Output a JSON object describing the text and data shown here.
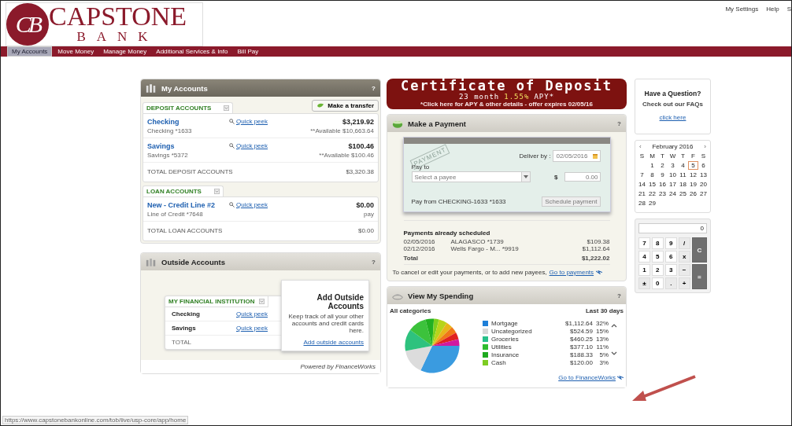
{
  "header": {
    "logo_initials": "CB",
    "logo_name": "CAPSTONE",
    "logo_sub": "BANK",
    "links": [
      "My Settings",
      "Help",
      "S"
    ]
  },
  "nav": [
    {
      "label": "My Accounts",
      "selected": true
    },
    {
      "label": "Move Money",
      "selected": false
    },
    {
      "label": "Manage Money",
      "selected": false
    },
    {
      "label": "Additional Services & Info",
      "selected": false
    },
    {
      "label": "Bill Pay",
      "selected": false
    }
  ],
  "my_accounts": {
    "title": "My Accounts",
    "help": "?",
    "transfer_button": "Make a transfer",
    "groups": [
      {
        "tab": "DEPOSIT ACCOUNTS",
        "total_label": "TOTAL DEPOSIT ACCOUNTS",
        "total": "$3,320.38",
        "accounts": [
          {
            "name": "Checking",
            "number": "Checking *1633",
            "peek": "Quick peek",
            "balance": "$3,219.92",
            "note": "**Available $10,663.64"
          },
          {
            "name": "Savings",
            "number": "Savings *5372",
            "peek": "Quick peek",
            "balance": "$100.46",
            "note": "**Available $100.46"
          }
        ]
      },
      {
        "tab": "LOAN ACCOUNTS",
        "total_label": "TOTAL LOAN ACCOUNTS",
        "total": "$0.00",
        "accounts": [
          {
            "name": "New - Credit Line #2",
            "number": "Line of Credit *7648",
            "peek": "Quick peek",
            "balance": "$0.00",
            "note": "pay"
          }
        ]
      }
    ]
  },
  "outside_accounts": {
    "title": "Outside Accounts",
    "help": "?",
    "tab": "MY FINANCIAL INSTITUTION",
    "rows": [
      {
        "name": "Checking",
        "peek": "Quick peek"
      },
      {
        "name": "Savings",
        "peek": "Quick peek"
      }
    ],
    "total_label": "TOTAL",
    "promo_title": "Add Outside Accounts",
    "promo_text": "Keep track of all your other accounts and credit cards here.",
    "promo_link": "Add outside accounts",
    "powered_by": "Powered by FinanceWorks"
  },
  "cd_banner": {
    "title": "Certificate of Deposit",
    "term": "23 month",
    "rate": "1.55%",
    "apy": "APY*",
    "fine_print": "*Click here for APY & other details - offer expires 02/05/16"
  },
  "payment": {
    "title": "Make a Payment",
    "help": "?",
    "stamp": "PAYMENT",
    "deliver_label": "Deliver by :",
    "deliver_date": "02/05/2016",
    "pay_to_label": "Pay to",
    "payee_placeholder": "Select a payee",
    "currency": "$",
    "amount": "0.00",
    "pay_from": "Pay from CHECKING-1633 *1633",
    "schedule_button": "Schedule payment",
    "schedule_disabled": true,
    "scheduled_title": "Payments already scheduled",
    "scheduled": [
      {
        "date": "02/05/2016",
        "payee": "ALAGASCO *1739",
        "amount": "$109.38"
      },
      {
        "date": "02/12/2016",
        "payee": "Wells Fargo - M... *9919",
        "amount": "$1,112.64"
      }
    ],
    "total_label": "Total",
    "total": "$1,222.02",
    "footer_text": "To cancel or edit your payments, or to add new payees,",
    "footer_link": "Go to payments"
  },
  "spending": {
    "title": "View My Spending",
    "help": "?",
    "filter": "All categories",
    "period": "Last 30 days",
    "legend": [
      {
        "name": "Mortgage",
        "amount": "$1,112.64",
        "share": "32%",
        "color": "#1e7fd8"
      },
      {
        "name": "Uncategorized",
        "amount": "$524.59",
        "share": "15%",
        "color": "#d8d8d8"
      },
      {
        "name": "Groceries",
        "amount": "$460.25",
        "share": "13%",
        "color": "#27c08a"
      },
      {
        "name": "Utilities",
        "amount": "$377.10",
        "share": "11%",
        "color": "#2ebd2e"
      },
      {
        "name": "Insurance",
        "amount": "$188.33",
        "share": "5%",
        "color": "#1faa1f"
      },
      {
        "name": "Cash",
        "amount": "$120.00",
        "share": "3%",
        "color": "#7dcc22"
      }
    ],
    "link": "Go to FinanceWorks"
  },
  "question": {
    "title": "Have a Question?",
    "subtitle": "Check out our FAQs",
    "link": "click here"
  },
  "calendar": {
    "prev": "‹",
    "next": "›",
    "month": "February 2016",
    "weekdays": [
      "S",
      "M",
      "T",
      "W",
      "T",
      "F",
      "S"
    ],
    "weeks": [
      [
        {
          "day": "1",
          "selected": false
        },
        {
          "day": "2",
          "selected": false
        },
        {
          "day": "3",
          "selected": false
        },
        {
          "day": "4",
          "selected": false
        },
        {
          "day": "5",
          "selected": true
        },
        {
          "day": "6",
          "selected": false
        }
      ],
      [
        {
          "day": "7",
          "selected": false
        },
        {
          "day": "8",
          "selected": false
        },
        {
          "day": "9",
          "selected": false
        },
        {
          "day": "10",
          "selected": false
        },
        {
          "day": "11",
          "selected": false
        },
        {
          "day": "12",
          "selected": false
        },
        {
          "day": "13",
          "selected": false
        }
      ],
      [
        {
          "day": "14",
          "selected": false
        },
        {
          "day": "15",
          "selected": false
        },
        {
          "day": "16",
          "selected": false
        },
        {
          "day": "17",
          "selected": false
        },
        {
          "day": "18",
          "selected": false
        },
        {
          "day": "19",
          "selected": false
        },
        {
          "day": "20",
          "selected": false
        }
      ],
      [
        {
          "day": "21",
          "selected": false
        },
        {
          "day": "22",
          "selected": false
        },
        {
          "day": "23",
          "selected": false
        },
        {
          "day": "24",
          "selected": false
        },
        {
          "day": "25",
          "selected": false
        },
        {
          "day": "26",
          "selected": false
        },
        {
          "day": "27",
          "selected": false
        }
      ],
      [
        {
          "day": "28",
          "selected": false
        },
        {
          "day": "29",
          "selected": false
        }
      ]
    ]
  },
  "calculator": {
    "display": "0",
    "keys": [
      {
        "label": "7",
        "kind": "digit"
      },
      {
        "label": "8",
        "kind": "digit"
      },
      {
        "label": "9",
        "kind": "digit"
      },
      {
        "label": "/",
        "kind": "op"
      },
      {
        "label": "C",
        "kind": "clear"
      },
      {
        "label": "4",
        "kind": "digit"
      },
      {
        "label": "5",
        "kind": "digit"
      },
      {
        "label": "6",
        "kind": "digit"
      },
      {
        "label": "x",
        "kind": "op"
      },
      {
        "label": "1",
        "kind": "digit"
      },
      {
        "label": "2",
        "kind": "digit"
      },
      {
        "label": "3",
        "kind": "digit"
      },
      {
        "label": "−",
        "kind": "op"
      },
      {
        "label": "=",
        "kind": "equals"
      },
      {
        "label": "±",
        "kind": "op"
      },
      {
        "label": "0",
        "kind": "digit"
      },
      {
        "label": ".",
        "kind": "op"
      },
      {
        "label": "+",
        "kind": "op"
      }
    ]
  },
  "status_bar": {
    "url": "https://www.capstonebankonline.com/tob/live/usp-core/app/home"
  }
}
